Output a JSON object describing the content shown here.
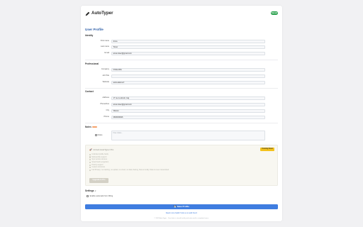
{
  "app": {
    "name": "AutoTyper",
    "badge": "Saved"
  },
  "page": {
    "title": "User Profile"
  },
  "sections": {
    "identity": {
      "title": "Identity",
      "fields": [
        {
          "label": "First name",
          "value": "Anna"
        },
        {
          "label": "Last name",
          "value": "Tower"
        },
        {
          "label": "Email",
          "value": "anna.tower@gmail.com"
        }
      ]
    },
    "professional": {
      "title": "Professional",
      "fields": [
        {
          "label": "Company",
          "value": "Chilla ARG"
        },
        {
          "label": "Job Title",
          "value": ""
        },
        {
          "label": "Website",
          "value": "www.adama.fr"
        }
      ]
    },
    "contact": {
      "title": "Contact",
      "fields": [
        {
          "label": "Address",
          "value": "17 rue Ludovoit, Gaj"
        },
        {
          "label": "Phone/Fax",
          "value": "anna.tower@gmail.com"
        },
        {
          "label": "City",
          "value": "Villeton"
        },
        {
          "label": "Phone",
          "value": "0606060626"
        }
      ]
    }
  },
  "notes": {
    "title": "Notes",
    "label": "Notes",
    "placeholder": "Free notes..."
  },
  "pro": {
    "title": "Unlock AutoTyper Pro",
    "coming_soon": "Coming Soon",
    "features": [
      "Unlimited profile fields",
      "Multi-profile support",
      "Sync across devices",
      "Smart field recognition",
      "Priority support",
      "Custom shortcuts",
      "Full Privacy: no tracking, no upload, no cloud, no data sharing, Stores locally. Data is never transmitted."
    ],
    "upgrade": "Upgrade to Pro"
  },
  "settings": {
    "title": "Settings",
    "autosave_label": "Enable automatic form filling"
  },
  "actions": {
    "save": "Save Profile",
    "link": "Need more fields? Ask us to add them!"
  },
  "footer": "© 2025 AutoTyper · Your data is stored locally and only used to complete forms.",
  "colors": {
    "accent": "#3f7de0",
    "title": "#2f5fa8",
    "badge": "#2ca24f",
    "coming": "#f4c21b"
  }
}
